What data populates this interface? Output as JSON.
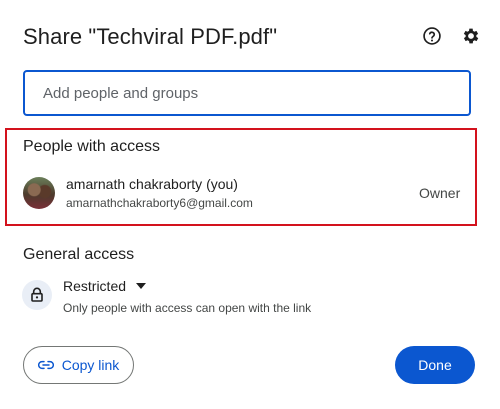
{
  "dialog": {
    "title": "Share \"Techviral PDF.pdf\"",
    "help_icon": "help-circle-icon",
    "settings_icon": "gear-icon"
  },
  "search": {
    "placeholder": "Add people and groups",
    "value": ""
  },
  "people_with_access": {
    "heading": "People with access",
    "users": [
      {
        "name": "amarnath chakraborty (you)",
        "email": "amarnathchakraborty6@gmail.com",
        "role": "Owner"
      }
    ]
  },
  "general_access": {
    "heading": "General access",
    "selected": "Restricted",
    "description": "Only people with access can open with the link",
    "icon": "lock-icon"
  },
  "footer": {
    "copy_link_label": "Copy link",
    "done_label": "Done"
  },
  "colors": {
    "accent": "#0b57d0",
    "highlight_border": "#d3121d"
  }
}
